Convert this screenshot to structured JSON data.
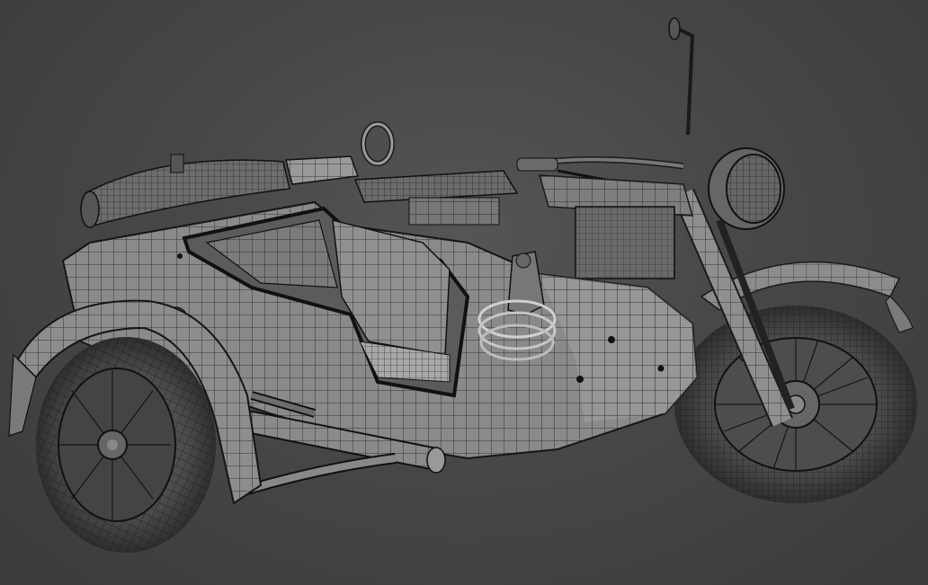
{
  "scene": {
    "subject_icon": "wireframe-model",
    "colors": {
      "background_center": "#555555",
      "background_edge": "#3b3b3b",
      "surface": "#8a8a8a",
      "surface_light": "#a5a5a5",
      "surface_dark": "#6e6e6e",
      "wire": "#1a1a1a",
      "tire": "#2a2a2a",
      "ring_highlight": "#d0d0d0"
    }
  }
}
